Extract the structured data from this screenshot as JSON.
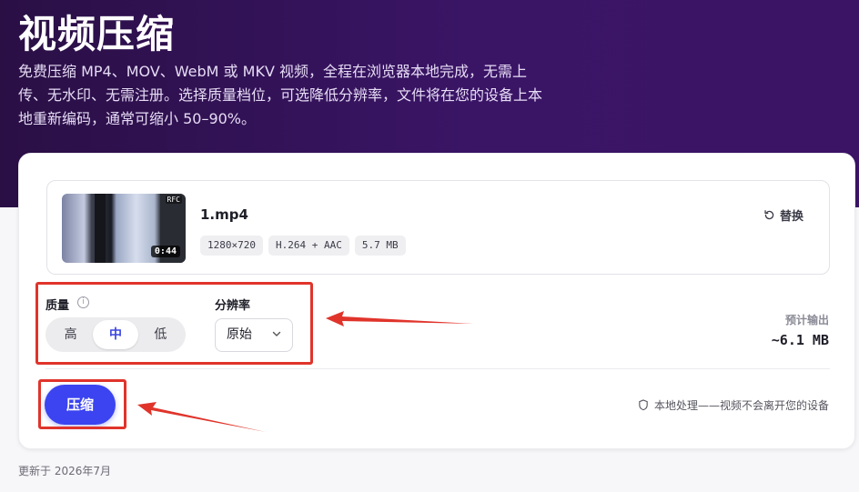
{
  "header": {
    "title": "视频压缩",
    "description": "免费压缩 MP4、MOV、WebM 或 MKV 视频，全程在浏览器本地完成，无需上传、无水印、无需注册。选择质量档位，可选降低分辨率，文件将在您的设备上本地重新编码，通常可缩小 50–90%。"
  },
  "file": {
    "name": "1.mp4",
    "duration": "0:44",
    "thumb_tag": "RFC",
    "chips": [
      "1280×720",
      "H.264 + AAC",
      "5.7 MB"
    ],
    "replace_label": "替换",
    "replace_icon": "refresh-icon"
  },
  "quality": {
    "label": "质量",
    "info_icon": "info-icon",
    "options": [
      "高",
      "中",
      "低"
    ],
    "selected": "中"
  },
  "resolution": {
    "label": "分辨率",
    "selected": "原始"
  },
  "estimate": {
    "label": "预计输出",
    "value": "~6.1 MB"
  },
  "actions": {
    "compress_label": "压缩"
  },
  "privacy_note": "本地处理——视频不会离开您的设备",
  "footer": {
    "updated": "更新于 2026年7月"
  },
  "colors": {
    "accent": "#3b44f0",
    "hero_bg": "#341460",
    "annotation": "#e0342b"
  }
}
